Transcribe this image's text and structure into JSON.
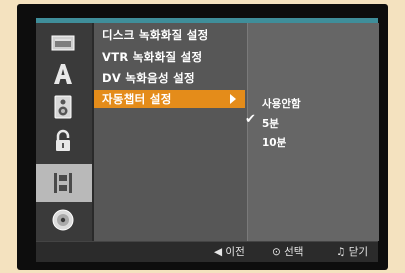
{
  "menu": {
    "items": [
      {
        "label": "디스크 녹화화질 설정"
      },
      {
        "label": "VTR 녹화화질 설정"
      },
      {
        "label": "DV 녹화음성 설정"
      },
      {
        "label": "자동챕터 설정",
        "selected": true
      }
    ]
  },
  "submenu": {
    "items": [
      {
        "label": "사용안함",
        "checked": false
      },
      {
        "label": "5분",
        "checked": true
      },
      {
        "label": "10분",
        "checked": false
      }
    ]
  },
  "icons": {
    "items": [
      {
        "name": "disc-tray-icon"
      },
      {
        "name": "font-a-icon"
      },
      {
        "name": "speaker-icon"
      },
      {
        "name": "lock-icon"
      },
      {
        "name": "film-icon",
        "active": true
      },
      {
        "name": "disc-icon"
      }
    ]
  },
  "hints": {
    "back": "◀ 이전",
    "select": "⊙ 선택",
    "close": "♫ 닫기"
  },
  "colors": {
    "accent": "#e48c1a",
    "teal": "#3f8e9a",
    "background": "#f4e2bf"
  }
}
